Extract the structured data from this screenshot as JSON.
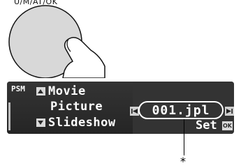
{
  "knob_label": "U/M/AT/OK",
  "display": {
    "mode": "PSM",
    "menu_items": [
      "Movie",
      "Picture",
      "Slideshow"
    ],
    "file_name": "001.jpl",
    "set_label": "Set",
    "ok_label": "OK"
  },
  "footnote": "*"
}
